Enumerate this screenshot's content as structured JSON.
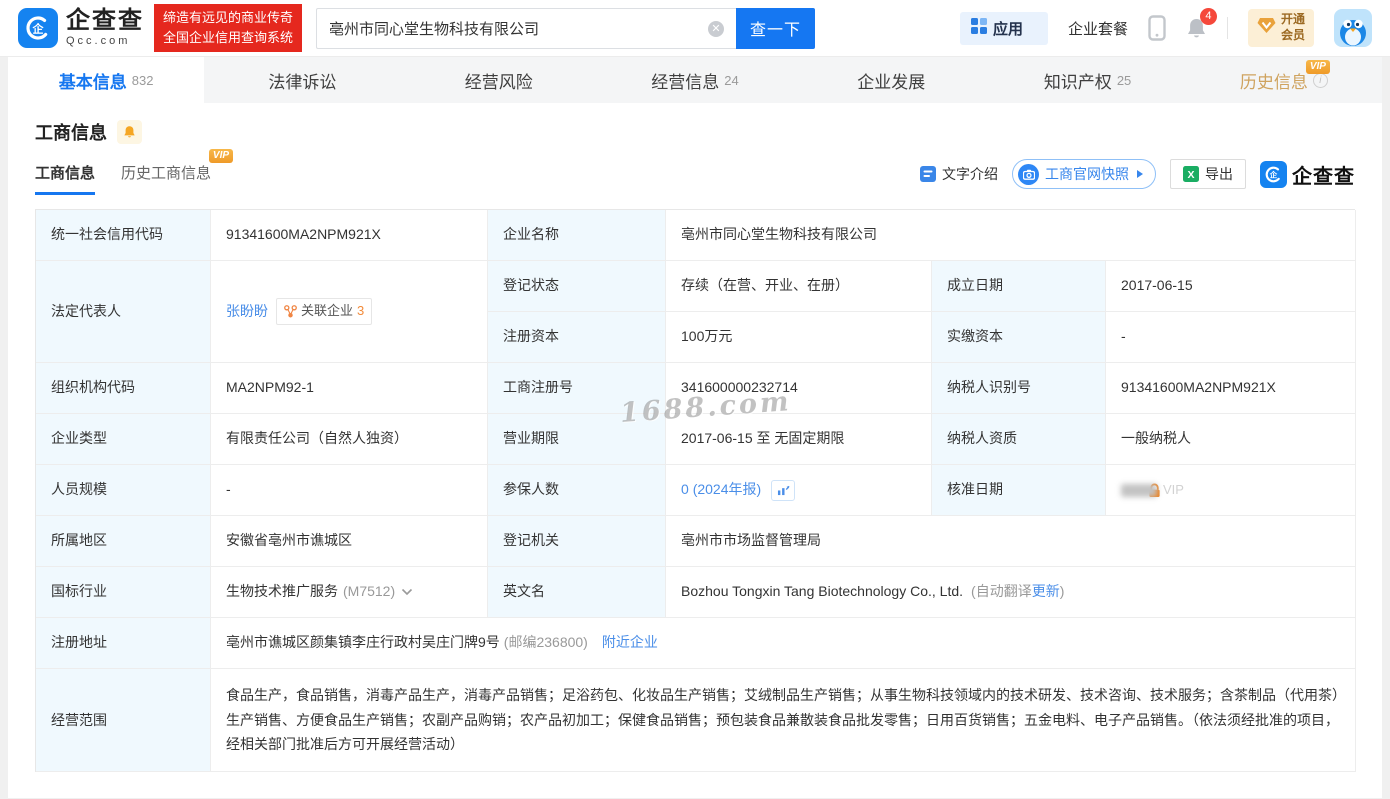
{
  "colors": {
    "accent": "#1677f0",
    "link": "#4a8ee8",
    "label_bg": "#f0f9fe",
    "vip_orange": "#f0a23c",
    "slogan_red": "#e5281e"
  },
  "header": {
    "logo": {
      "brand": "企查查",
      "domain": "Qcc.com",
      "slogan_line1": "缔造有远见的商业传奇",
      "slogan_line2": "全国企业信用查询系统"
    },
    "search": {
      "value": "亳州市同心堂生物科技有限公司",
      "button": "查一下"
    },
    "nav": {
      "apps": "应用",
      "packages": "企业套餐",
      "notification_count": "4",
      "vip_line1": "开通",
      "vip_line2": "会员"
    }
  },
  "tabs": [
    {
      "label": "基本信息",
      "count": "832"
    },
    {
      "label": "法律诉讼",
      "count": ""
    },
    {
      "label": "经营风险",
      "count": ""
    },
    {
      "label": "经营信息",
      "count": "24"
    },
    {
      "label": "企业发展",
      "count": ""
    },
    {
      "label": "知识产权",
      "count": "25"
    },
    {
      "label": "历史信息",
      "count": "",
      "vip": "VIP"
    }
  ],
  "section": {
    "title": "工商信息"
  },
  "subtabs": {
    "current": "工商信息",
    "history": "历史工商信息",
    "vip_badge": "VIP"
  },
  "toolbar": {
    "text_intro": "文字介绍",
    "snapshot": "工商官网快照",
    "export": "导出",
    "brand": "企查查"
  },
  "watermark": "1688.com",
  "fields": {
    "credit_code": {
      "label": "统一社会信用代码",
      "value": "91341600MA2NPM921X"
    },
    "company_name": {
      "label": "企业名称",
      "value": "亳州市同心堂生物科技有限公司"
    },
    "legal_rep": {
      "label": "法定代表人",
      "value": "张盼盼",
      "related_label": "关联企业",
      "related_count": "3"
    },
    "reg_status": {
      "label": "登记状态",
      "value": "存续（在营、开业、在册）"
    },
    "establish_date": {
      "label": "成立日期",
      "value": "2017-06-15"
    },
    "reg_capital": {
      "label": "注册资本",
      "value": "100万元"
    },
    "paid_capital": {
      "label": "实缴资本",
      "value": "-"
    },
    "org_code": {
      "label": "组织机构代码",
      "value": "MA2NPM92-1"
    },
    "reg_number": {
      "label": "工商注册号",
      "value": "341600000232714"
    },
    "taxpayer_id": {
      "label": "纳税人识别号",
      "value": "91341600MA2NPM921X"
    },
    "company_type": {
      "label": "企业类型",
      "value": "有限责任公司（自然人独资）"
    },
    "business_term": {
      "label": "营业期限",
      "value": "2017-06-15 至 无固定期限"
    },
    "taxpayer_quality": {
      "label": "纳税人资质",
      "value": "一般纳税人"
    },
    "staff_size": {
      "label": "人员规模",
      "value": "-"
    },
    "insured_count": {
      "label": "参保人数",
      "value": "0",
      "report": "(2024年报)"
    },
    "approval_date": {
      "label": "核准日期",
      "vip_label": "VIP"
    },
    "region": {
      "label": "所属地区",
      "value": "安徽省亳州市谯城区"
    },
    "reg_authority": {
      "label": "登记机关",
      "value": "亳州市市场监督管理局"
    },
    "industry": {
      "label": "国标行业",
      "value": "生物技术推广服务",
      "code": "(M7512)"
    },
    "english_name": {
      "label": "英文名",
      "value": "Bozhou Tongxin Tang Biotechnology Co., Ltd.",
      "note_open": "(自动翻译",
      "note_update": "更新",
      "note_close": ")"
    },
    "address": {
      "label": "注册地址",
      "value": "亳州市谯城区颜集镇李庄行政村吴庄门牌9号",
      "postcode": "(邮编236800)",
      "nearby": "附近企业"
    },
    "business_scope": {
      "label": "经营范围",
      "value": "食品生产，食品销售，消毒产品生产，消毒产品销售；足浴药包、化妆品生产销售；艾绒制品生产销售；从事生物科技领域内的技术研发、技术咨询、技术服务；含茶制品（代用茶）生产销售、方便食品生产销售；农副产品购销；农产品初加工；保健食品销售；预包装食品兼散装食品批发零售；日用百货销售；五金电料、电子产品销售。（依法须经批准的项目，经相关部门批准后方可开展经营活动）"
    }
  }
}
